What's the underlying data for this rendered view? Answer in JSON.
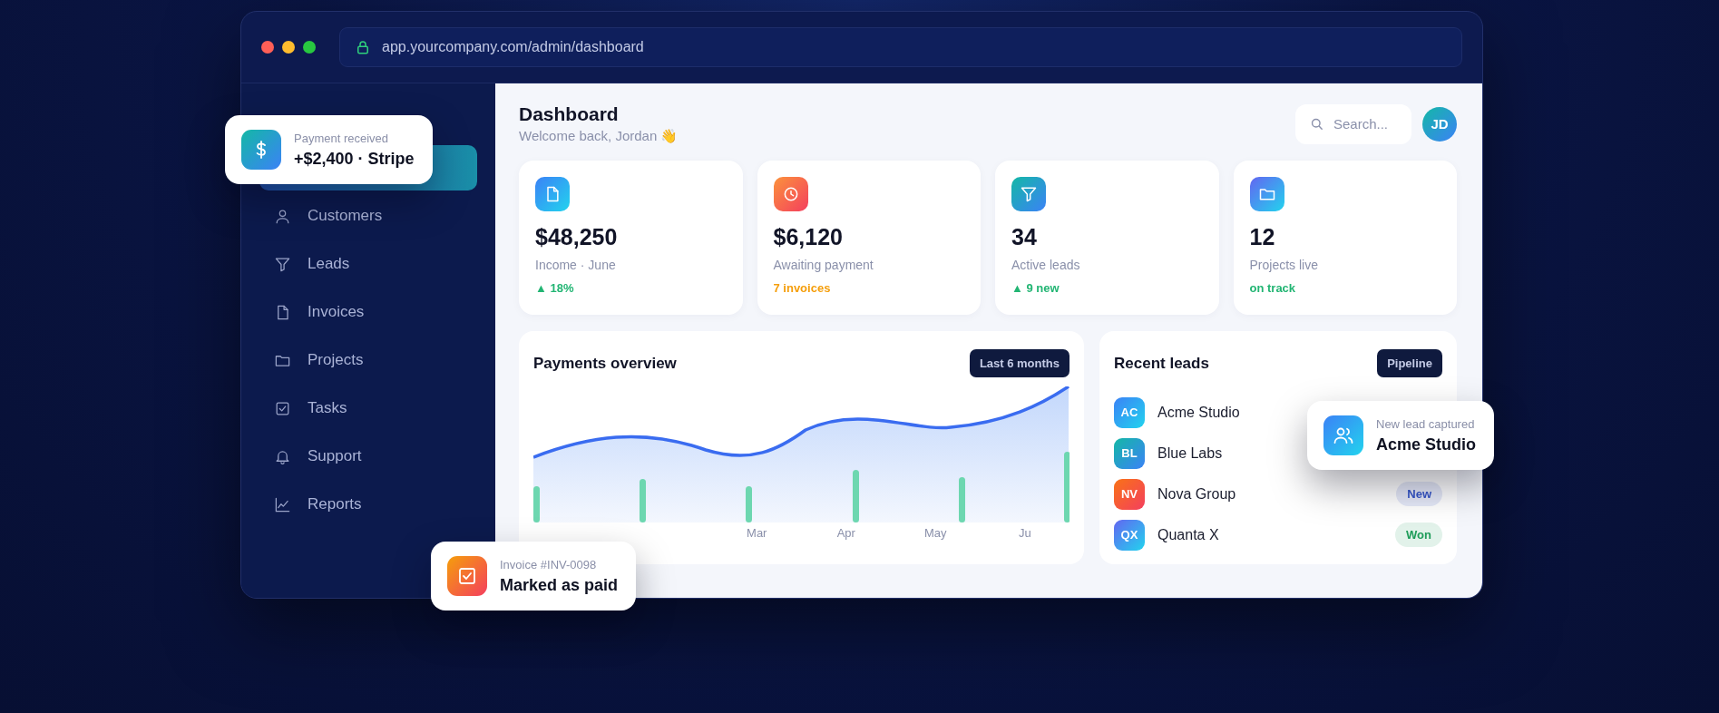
{
  "browser": {
    "url": "app.yourcompany.com/admin/dashboard"
  },
  "sidebar": {
    "items": [
      {
        "selected": true
      },
      {
        "label": "Customers",
        "selected": false
      },
      {
        "label": "Leads",
        "selected": false
      },
      {
        "label": "Invoices",
        "selected": false
      },
      {
        "label": "Projects",
        "selected": false
      },
      {
        "label": "Tasks",
        "selected": false
      },
      {
        "label": "Support",
        "selected": false
      },
      {
        "label": "Reports",
        "selected": false
      }
    ]
  },
  "header": {
    "title": "Dashboard",
    "subtitle": "Welcome back, Jordan 👋",
    "search": {
      "placeholder": "Search..."
    },
    "avatar": "JD"
  },
  "stats": [
    {
      "value": "$48,250",
      "label": "Income · June",
      "note": "▲ 18%",
      "color": "#22b573"
    },
    {
      "value": "$6,120",
      "label": "Awaiting payment",
      "note": "7 invoices",
      "color": "#f59e0b"
    },
    {
      "value": "34",
      "label": "Active leads",
      "note": "▲ 9 new",
      "color": "#22b573"
    },
    {
      "value": "12",
      "label": "Projects live",
      "note": "on track",
      "color": "#22b573"
    }
  ],
  "payments": {
    "title": "Payments overview",
    "range_button": "Last 6 months",
    "x_labels": [
      "Mar",
      "Apr",
      "May",
      "Ju"
    ]
  },
  "leads": {
    "title": "Recent leads",
    "button": "Pipeline",
    "rows": [
      {
        "initials": "AC",
        "name": "Acme Studio"
      },
      {
        "initials": "BL",
        "name": "Blue Labs"
      },
      {
        "initials": "NV",
        "name": "Nova Group",
        "status": {
          "label": "New",
          "color": "#3657c9"
        }
      },
      {
        "initials": "QX",
        "name": "Quanta X",
        "status": {
          "label": "Won",
          "color": "#1f9d5a"
        }
      }
    ]
  },
  "toasts": [
    {
      "caption": "Payment received",
      "text": "+$2,400 · Stripe"
    },
    {
      "caption": "Invoice #INV-0098",
      "text": "Marked as paid"
    },
    {
      "caption": "New lead captured",
      "text": "Acme Studio"
    }
  ]
}
